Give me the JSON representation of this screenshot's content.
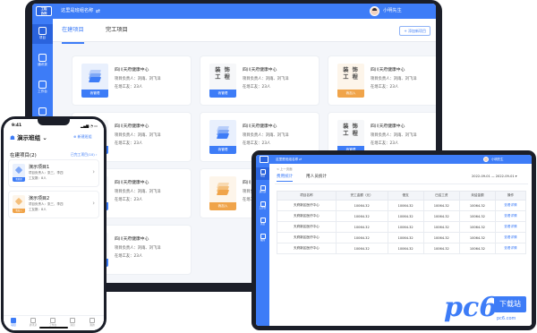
{
  "desktop": {
    "logo_text": "工程\n协同",
    "company": "这里是班组名称",
    "swap_icon": "swap-icon",
    "user_name": "小明先生",
    "sidebar": [
      {
        "label": "项目",
        "icon": "grid-icon",
        "active": true
      },
      {
        "label": "通讯录",
        "icon": "contacts-icon",
        "active": false
      },
      {
        "label": "工作台",
        "icon": "monitor-icon",
        "active": false
      },
      {
        "label": "消息",
        "icon": "message-icon",
        "active": false
      }
    ],
    "tabs": [
      "在建项目",
      "完工项目"
    ],
    "add_button": "+ 添加新项目",
    "cards": [
      {
        "thumb": "blue",
        "badge": "我管理",
        "deco": "",
        "title": "四川天府健康中心",
        "managers": "项目负责人：刘雨、刘飞洋",
        "workers": "在场工友：23人"
      },
      {
        "thumb": "white",
        "badge": "我管理",
        "deco": "装 饰\n工 程",
        "title": "四川天府健康中心",
        "managers": "项目负责人：刘雨、刘飞洋",
        "workers": "在场工友：23人"
      },
      {
        "thumb": "orange",
        "badge": "我加入",
        "deco": "装 饰\n工 程",
        "title": "四川天府健康中心",
        "managers": "项目负责人：刘雨、刘飞洋",
        "workers": "在场工友：23人"
      },
      {
        "thumb": "white",
        "badge": "我管理",
        "deco": "",
        "title": "四川天府健康中心",
        "managers": "项目负责人：刘雨、刘飞洋",
        "workers": "在场工友：23人"
      },
      {
        "thumb": "blue",
        "badge": "我管理",
        "deco": "",
        "title": "四川天府健康中心",
        "managers": "项目负责人：刘雨、刘飞洋",
        "workers": "在场工友：23人"
      },
      {
        "thumb": "white",
        "badge": "我管理",
        "deco": "装 饰\n工 程",
        "title": "四川天府健康中心",
        "managers": "项目负责人：刘雨、刘飞洋",
        "workers": "在场工友：23人"
      },
      {
        "thumb": "white",
        "badge": "我管理",
        "deco": "",
        "title": "四川天府健康中心",
        "managers": "项目负责人：刘雨、刘飞洋",
        "workers": "在场工友：23人"
      },
      {
        "thumb": "orange",
        "badge": "我加入",
        "deco": "",
        "title": "四川天府健康中心",
        "managers": "项目负责人：刘雨、刘飞洋",
        "workers": "在场工友：23人"
      },
      {
        "thumb": "white",
        "badge": "我管理",
        "deco": "",
        "title": "四川天府健康中心",
        "managers": "项目负责人：刘雨、刘飞洋",
        "workers": "在场工友：23人"
      },
      {
        "thumb": "white",
        "badge": "我管理",
        "deco": "装 饰\n工 程",
        "title": "四川天府健康中心",
        "managers": "项目负责人：刘雨、刘飞洋",
        "workers": "在场工友：23人"
      }
    ]
  },
  "phone": {
    "time": "9:41",
    "status": "▂▄▆ ◔ ▭",
    "team": "演示班组 ⌄",
    "new_team": "⊕ 新建班组",
    "section": "在建项目(2)",
    "done_link": "已完工项目(10) ›",
    "projects": [
      {
        "title": "演示项目1",
        "thumb": "blue",
        "badge": "我管理",
        "managers": "项目负责人：张三、李四",
        "workers": "工友数：8人"
      },
      {
        "title": "演示项目2",
        "thumb": "orange",
        "badge": "我加入",
        "managers": "项目负责人：张三、李四",
        "workers": "工友数：8人"
      }
    ],
    "nav": [
      {
        "label": "项目",
        "active": true
      },
      {
        "label": "通讯录",
        "active": false
      },
      {
        "label": "工作台",
        "active": false
      },
      {
        "label": "消息",
        "active": false
      },
      {
        "label": "我的",
        "active": false
      }
    ]
  },
  "tablet": {
    "company": "这里是班组名称 ⇄",
    "user_name": "小明先生",
    "sidebar": [
      {
        "label": "项目",
        "active": true
      },
      {
        "label": "通讯录",
        "active": false
      },
      {
        "label": "工作台",
        "active": false
      },
      {
        "label": "消息",
        "active": false
      },
      {
        "label": "我的",
        "active": false
      }
    ],
    "breadcrumb": "< 上一页面",
    "tabs": [
      "费用统计",
      "用人员统计"
    ],
    "date_range": "2022-09-01 — 2022-09-01 ▾",
    "table": {
      "headers": [
        "项目名称",
        "完工金额（元）",
        "借支",
        "已结工资",
        "未结金额",
        "操作"
      ],
      "rows": [
        [
          "天府新区医疗中心",
          "10064.32",
          "10064.32",
          "10064.32",
          "10064.32",
          "查看详情"
        ],
        [
          "天府新区医疗中心",
          "10064.32",
          "10064.32",
          "10064.32",
          "10064.32",
          "查看详情"
        ],
        [
          "天府新区医疗中心",
          "10064.32",
          "10064.32",
          "10064.32",
          "10064.32",
          "查看详情"
        ],
        [
          "天府新区医疗中心",
          "10064.32",
          "10064.32",
          "10064.32",
          "10064.32",
          "查看详情"
        ],
        [
          "天府新区医疗中心",
          "10064.32",
          "10064.32",
          "10064.32",
          "10064.32",
          "查看详情"
        ]
      ]
    }
  },
  "watermark": {
    "logo": "pc6",
    "text": "下载站",
    "url": "pc6.com"
  },
  "colors": {
    "brand": "#3d7cf7",
    "brand_dark": "#2a63dd",
    "orange": "#f0a44a",
    "bezel": "#1b1e28"
  }
}
